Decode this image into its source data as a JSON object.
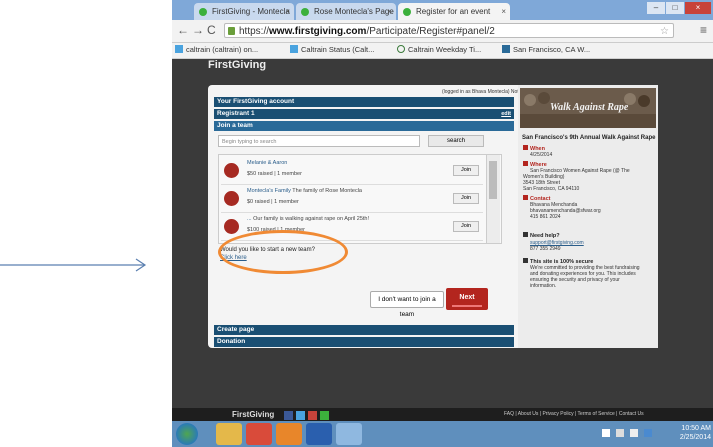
{
  "browser": {
    "tabs": [
      {
        "title": "FirstGiving - Montecla"
      },
      {
        "title": "Rose Montecla's Page"
      },
      {
        "title": "Register for an event"
      }
    ],
    "url_prefix": "https://",
    "url_host": "www.firstgiving.com",
    "url_path": "/Participate/Register#panel/2",
    "bookmarks": [
      {
        "label": "caltrain (caltrain) on..."
      },
      {
        "label": "Caltrain Status (Calt..."
      },
      {
        "label": "Caltrain Weekday Ti..."
      },
      {
        "label": "San Francisco, CA W..."
      }
    ]
  },
  "site": {
    "logo_text": "FirstGiving",
    "breadcrumb": "(logged in as Bhava Montecla) Not Bhava Montecla?"
  },
  "form": {
    "account_label": "Your FirstGiving account",
    "registrant_label": "Registrant 1",
    "edit_label": "edit",
    "join_team_label": "Join a team",
    "search_placeholder": "Begin typing to search",
    "search_button": "search",
    "join_button": "Join",
    "teams": [
      {
        "name": "Melanie & Aaron",
        "desc": "",
        "meta": "$50 raised | 1 member"
      },
      {
        "name": "Montecla's Family",
        "desc": "The family of Rose Montecla",
        "meta": "$0 raised | 1 member"
      },
      {
        "name": "...",
        "desc": "Our family is walking against rape on April 25th!",
        "meta": "$100 raised | 1 member"
      }
    ],
    "new_team_question": "Would you like to start a new team?",
    "new_team_link": "Click here",
    "no_team_button": "I don't want to join a team",
    "next_button": "Next",
    "create_page_label": "Create page",
    "donation_label": "Donation"
  },
  "sidebar": {
    "banner_text": "Walk Against Rape",
    "event_title": "San Francisco's 9th Annual Walk Against Rape",
    "when_label": "When",
    "when_value": "4/25/2014",
    "where_label": "Where",
    "where_lines": [
      "San Francisco Women Against Rape (@ The",
      "Women's Building)",
      "3543 18th Street",
      "San Francisco, CA 94110"
    ],
    "contact_label": "Contact",
    "contact_lines": [
      "Bhavana Menchanda",
      "bhavanamenchanda@sfwar.org",
      "415 861 2024"
    ],
    "help_label": "Need help?",
    "help_email": "support@firstgiving.com",
    "help_phone": "877 355 2949",
    "secure_label": "This site is 100% secure",
    "secure_lines": [
      "We're committed to providing the best fundraising",
      "and donating experiences for you. This includes",
      "ensuring the security and privacy of your",
      "information."
    ]
  },
  "footer": {
    "logo": "FirstGiving",
    "links": "FAQ | About Us | Privacy Policy | Terms of Service | Contact Us"
  },
  "taskbar": {
    "time": "10:50 AM",
    "date": "2/25/2014"
  },
  "colors": {
    "accent_orange": "#f08a34",
    "nav_dark": "#1a4f73",
    "next_red": "#b3251e"
  }
}
